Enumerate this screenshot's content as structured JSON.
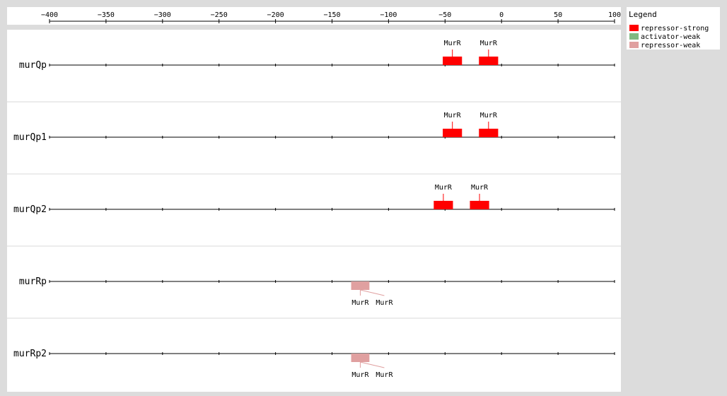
{
  "colors": {
    "repressor-strong": "#ff0000",
    "activator-weak": "#80b880",
    "repressor-weak": "#e0a0a0",
    "background": "#dcdcdc",
    "panel": "#ffffff",
    "separator": "#d8d8d8"
  },
  "axis": {
    "min": -400,
    "max": 100,
    "ticks": [
      -400,
      -350,
      -300,
      -250,
      -200,
      -150,
      -100,
      -50,
      0,
      50,
      100
    ],
    "tick_labels": [
      "−400",
      "−350",
      "−300",
      "−250",
      "−200",
      "−150",
      "−100",
      "−50",
      "0",
      "50",
      "100"
    ]
  },
  "legend": {
    "title": "Legend",
    "items": [
      {
        "label": "repressor-strong",
        "color": "#ff0000"
      },
      {
        "label": "activator-weak",
        "color": "#80b880"
      },
      {
        "label": "repressor-weak",
        "color": "#e0a0a0"
      }
    ]
  },
  "promoters": [
    {
      "name": "murQp",
      "sites": [
        {
          "label": "MurR",
          "start": -52,
          "end": -35,
          "type": "repressor-strong",
          "label_pos": "above"
        },
        {
          "label": "MurR",
          "start": -20,
          "end": -3,
          "type": "repressor-strong",
          "label_pos": "above"
        }
      ]
    },
    {
      "name": "murQp1",
      "sites": [
        {
          "label": "MurR",
          "start": -52,
          "end": -35,
          "type": "repressor-strong",
          "label_pos": "above"
        },
        {
          "label": "MurR",
          "start": -20,
          "end": -3,
          "type": "repressor-strong",
          "label_pos": "above"
        }
      ]
    },
    {
      "name": "murQp2",
      "sites": [
        {
          "label": "MurR",
          "start": -60,
          "end": -43,
          "type": "repressor-strong",
          "label_pos": "above"
        },
        {
          "label": "MurR",
          "start": -28,
          "end": -11,
          "type": "repressor-strong",
          "label_pos": "above"
        }
      ]
    },
    {
      "name": "murRp",
      "sites": [
        {
          "label": "MurR",
          "start": -133,
          "end": -117,
          "type": "repressor-weak",
          "label_pos": "below"
        },
        {
          "label": "MurR",
          "start": -133,
          "end": -117,
          "type": "repressor-weak",
          "label_pos": "below-shifted"
        }
      ]
    },
    {
      "name": "murRp2",
      "sites": [
        {
          "label": "MurR",
          "start": -133,
          "end": -117,
          "type": "repressor-weak",
          "label_pos": "below"
        },
        {
          "label": "MurR",
          "start": -133,
          "end": -117,
          "type": "repressor-weak",
          "label_pos": "below-shifted"
        }
      ]
    }
  ]
}
